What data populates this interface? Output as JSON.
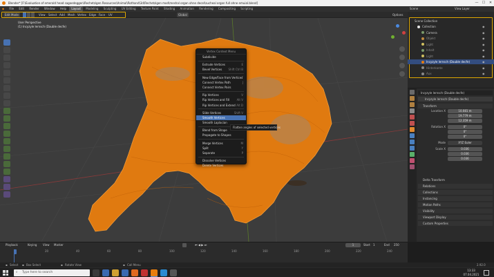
{
  "window": {
    "title": "Blender* [F:\\Evaluation of emerald head sagaedeggen\\Rechetzigen Resources\\Animal\\Rothand\\3d\\Rechetzigen mod\\meshal organ ohne decel\\sucheal organ full ohne emuial.blend]",
    "minimize": "—",
    "maximize": "☐",
    "close": "✕"
  },
  "topbar": {
    "menus": [
      "File",
      "Edit",
      "Render",
      "Window",
      "Help"
    ],
    "workspaces": [
      "Layout",
      "Modeling",
      "Sculpting",
      "UV Editing",
      "Texture Paint",
      "Shading",
      "Animation",
      "Rendering",
      "Compositing",
      "Scripting"
    ],
    "active_workspace": "Layout",
    "scene_label": "Scene",
    "view_layer_label": "View Layer"
  },
  "viewport": {
    "mode": "Edit Mode",
    "menu": [
      "View",
      "Select",
      "Add",
      "Mesh",
      "Vertex",
      "Edge",
      "Face",
      "UV"
    ],
    "orientation": "Global",
    "options": "Options",
    "view_name": "User Perspective",
    "object_name": "(1) Incyzyle lernsch (Dauble decfe)",
    "accent": "#e87d0d"
  },
  "context_menu": {
    "title": "Vertex Context Menu",
    "groups": [
      [
        {
          "label": "Subdivide",
          "shortcut": ""
        }
      ],
      [
        {
          "label": "Extrude Vertices",
          "shortcut": "E"
        },
        {
          "label": "Bevel Vertices",
          "shortcut": "Shift Ctrl B"
        }
      ],
      [
        {
          "label": "New Edge/Face from Vertices",
          "shortcut": "F"
        },
        {
          "label": "Connect Vertex Path",
          "shortcut": "J"
        },
        {
          "label": "Connect Vertex Pairs",
          "shortcut": ""
        }
      ],
      [
        {
          "label": "Rip Vertices",
          "shortcut": "V"
        },
        {
          "label": "Rip Vertices and Fill",
          "shortcut": "Alt V"
        },
        {
          "label": "Rip Vertices and Extend",
          "shortcut": "Alt D"
        }
      ],
      [
        {
          "label": "Slide Vertices",
          "shortcut": "Shift V"
        },
        {
          "label": "Smooth Vertices",
          "shortcut": ""
        },
        {
          "label": "Smooth Laplacian",
          "shortcut": ""
        }
      ],
      [
        {
          "label": "Blend from Shape",
          "shortcut": ""
        },
        {
          "label": "Propagate to Shapes",
          "shortcut": ""
        }
      ],
      [
        {
          "label": "Merge Vertices",
          "shortcut": "M"
        },
        {
          "label": "Split",
          "shortcut": "Y"
        },
        {
          "label": "Separate",
          "shortcut": "P"
        }
      ],
      [
        {
          "label": "Dissolve Vertices",
          "shortcut": ""
        },
        {
          "label": "Delete Vertices",
          "shortcut": ""
        }
      ]
    ],
    "selected": "Smooth Vertices",
    "tooltip": "Flatten angles of selected vertices"
  },
  "outliner": {
    "title": "Scene Collection",
    "rows": [
      {
        "label": "Collection",
        "color": "#d0d0d0"
      },
      {
        "label": "Camera",
        "color": "#d0d0d0"
      },
      {
        "label": "Objekt",
        "color": "#8a8a8a"
      },
      {
        "label": "Light",
        "color": "#8a8a8a"
      },
      {
        "label": "Inhalt",
        "color": "#8a8a8a"
      },
      {
        "label": "Light",
        "color": "#8a8a8a"
      },
      {
        "label": "Incyzyle lernsch (Dauble decfe)",
        "color": "#ffffff"
      },
      {
        "label": "Hinterkante",
        "color": "#8a8a8a"
      },
      {
        "label": "Aux",
        "color": "#8a8a8a"
      }
    ],
    "selected_index": 6
  },
  "properties": {
    "object_name": "Incyzyle lernsch (Dauble decfe)",
    "mesh_name": "Incyzyle lernsch (Dauble decfe)",
    "transform_label": "Transform",
    "location_label": "Location X",
    "location": [
      "10.081 m",
      "19.779 m",
      "12.359 m"
    ],
    "rotation_label": "Rotation X",
    "rotation": [
      "0°",
      "0°",
      "0°"
    ],
    "mode_label": "Mode",
    "mode_value": "XYZ Euler",
    "scale_label": "Scale X",
    "scale": [
      "0.036",
      "0.036",
      "0.036"
    ],
    "delta_label": "Delta Transform",
    "sections": [
      "Relations",
      "Collections",
      "Instancing",
      "Motion Paths",
      "Visibility",
      "Viewport Display",
      "Custom Properties"
    ]
  },
  "timeline": {
    "playback": "Playback",
    "keying": "Keying",
    "view": "View",
    "marker": "Marker",
    "current_frame": "1",
    "start_label": "Start",
    "start": "1",
    "end_label": "End",
    "end": "250",
    "ticks": [
      "0",
      "20",
      "40",
      "60",
      "80",
      "100",
      "120",
      "140",
      "160",
      "180",
      "200",
      "220",
      "240"
    ]
  },
  "statusbar": {
    "select": "Select",
    "box_select": "Box Select",
    "rotate_view": "Rotate View",
    "call_menu": "Call Menu",
    "version": "2.92.0"
  },
  "taskbar": {
    "search_placeholder": "Type here to search",
    "time": "13:33",
    "date": "07.04.2021"
  }
}
